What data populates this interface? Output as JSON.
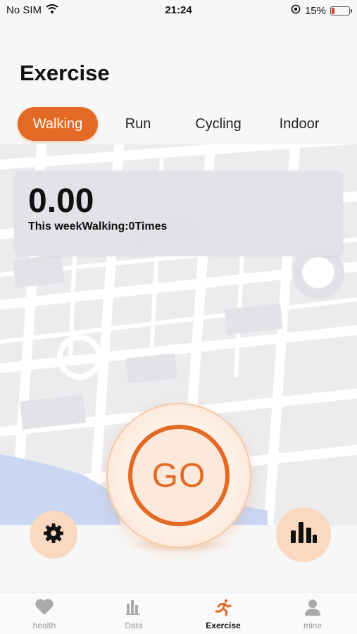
{
  "status_bar": {
    "carrier": "No SIM",
    "time": "21:24",
    "battery_percent": "15%",
    "battery_level": 0.15,
    "battery_color": "#e53935"
  },
  "page_title": "Exercise",
  "tabs": [
    {
      "label": "Walking",
      "active": true
    },
    {
      "label": "Run",
      "active": false
    },
    {
      "label": "Cycling",
      "active": false
    },
    {
      "label": "Indoor",
      "active": false
    }
  ],
  "summary": {
    "value": "0.00",
    "text": "This weekWalking:0Times"
  },
  "go_button": {
    "label": "GO"
  },
  "icons": {
    "settings": "gear-icon",
    "stats": "bar-chart-icon"
  },
  "tabbar": [
    {
      "label": "health",
      "icon": "heart-icon",
      "active": false
    },
    {
      "label": "Data",
      "icon": "bar-chart-icon",
      "active": false
    },
    {
      "label": "Exercise",
      "icon": "running-icon",
      "active": true
    },
    {
      "label": "mine",
      "icon": "person-icon",
      "active": false
    }
  ],
  "colors": {
    "accent": "#e36a24",
    "accent_light": "#fbd8c0",
    "card": "#e0e2e6"
  }
}
